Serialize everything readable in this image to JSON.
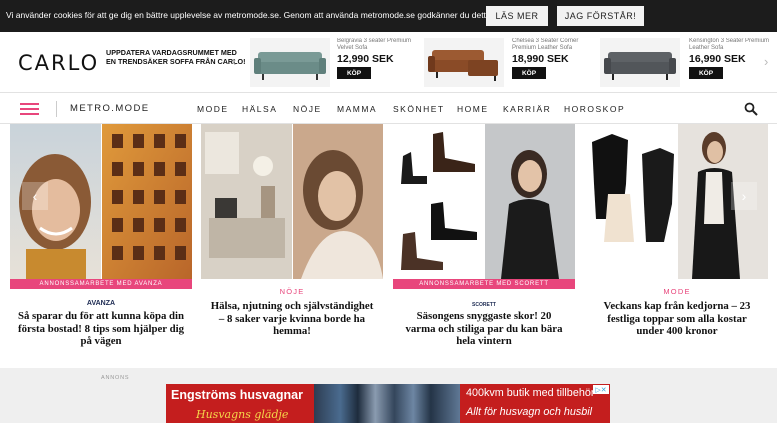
{
  "cookie": {
    "text": "Vi använder cookies för att ge dig en bättre upplevelse av metromode.se. Genom att använda metromode.se godkänner du detta",
    "more_label": "LÄS MER",
    "accept_label": "JAG FÖRSTÅR!"
  },
  "ad_banner": {
    "brand": "CARLO",
    "headline": "UPPDATERA VARDAGSRUMMET MED EN TRENDSÄKER SOFFA FRÅN CARLO!",
    "products": [
      {
        "name": "Belgravia 3 seater Premium Velvet Sofa",
        "price": "12,990 SEK",
        "buy_label": "KÖP"
      },
      {
        "name": "Chelsea 3 Seater Corner Premium Leather Sofa",
        "price": "18,990 SEK",
        "buy_label": "KÖP"
      },
      {
        "name": "Kensington 3 Seater Premium Leather Sofa",
        "price": "16,990 SEK",
        "buy_label": "KÖP"
      }
    ],
    "prev_icon": "‹",
    "next_icon": "›"
  },
  "nav": {
    "logo": "METRO.MODE",
    "items": [
      "MODE",
      "HÄLSA",
      "NÖJE",
      "MAMMA",
      "SKÖNHET",
      "HOME",
      "KARRIÄR",
      "HOROSKOP"
    ]
  },
  "articles": [
    {
      "label": "ANNONSSAMARBETE MED AVANZA",
      "sponsor": "AVANZA",
      "headline": "Så sparar du för att kunna köpa din första bostad! 8 tips som hjälper dig på vägen"
    },
    {
      "label": "NÖJE",
      "headline": "Hälsa, njutning och självständighet – 8 saker varje kvinna borde ha hemma!"
    },
    {
      "label": "ANNONSSAMARBETE MED SCORETT",
      "sponsor": "SCORETT",
      "headline": "Säsongens snyggaste skor! 20 varma och stiliga par du kan bära hela vintern"
    },
    {
      "label": "MODE",
      "headline": "Veckans kap från kedjorna – 23 festliga toppar som alla kostar under 400 kronor"
    }
  ],
  "slider": {
    "prev_icon": "‹",
    "next_icon": "›"
  },
  "bottom_ad": {
    "annons_label": "ANNONS",
    "left_title": "Engströms husvagnar",
    "left_sub": "Husvagns glädje",
    "right_line1": "400kvm butik med tillbehör",
    "right_line2": "Allt för husvagn och husbil",
    "adchoice": "▷✕"
  },
  "colors": {
    "accent": "#e8467c",
    "cookie_bg": "#1c1c1c",
    "ad_red": "#c41e1e"
  }
}
